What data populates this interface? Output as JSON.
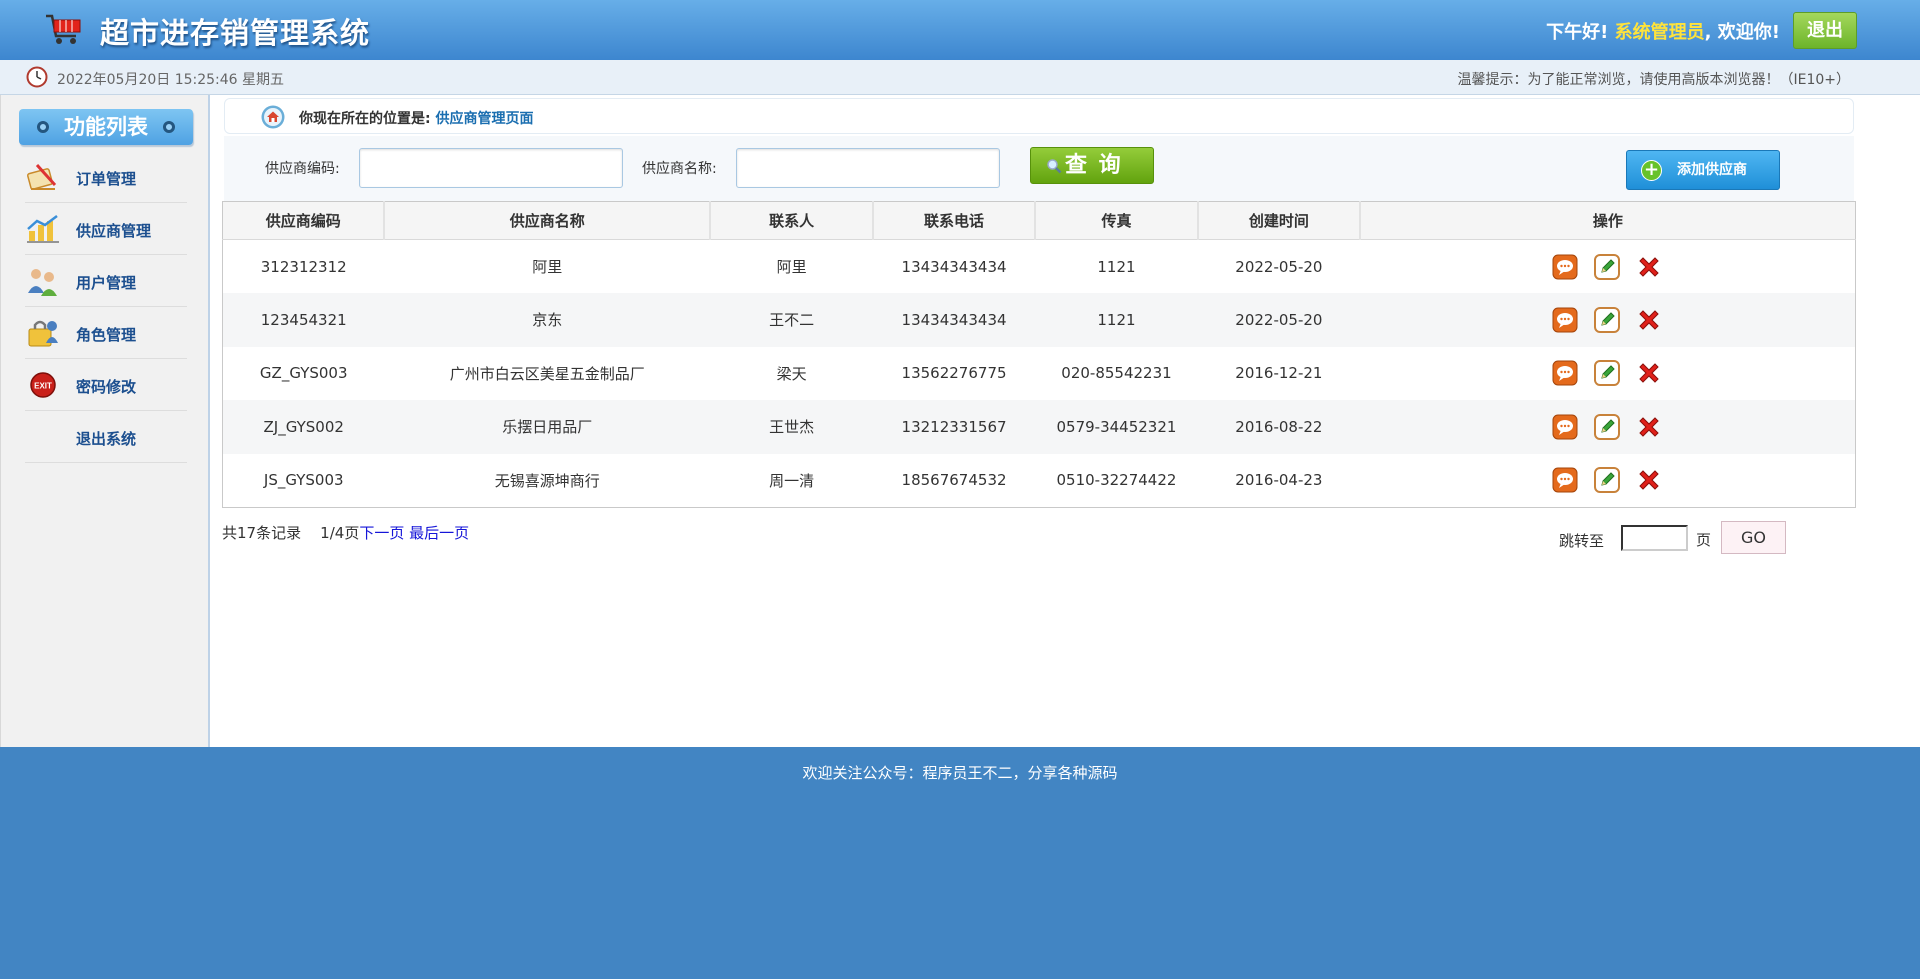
{
  "header": {
    "title": "超市进存销管理系统",
    "greeting_prefix": "下午好!",
    "username": "系统管理员",
    "greeting_suffix": ", 欢迎你!",
    "logout_label": "退出"
  },
  "subbar": {
    "datetime": "2022年05月20日 15:25:46 星期五",
    "tip": "温馨提示：为了能正常浏览，请使用高版本浏览器！（IE10+）"
  },
  "sidebar": {
    "title": "功能列表",
    "items": [
      {
        "label": "订单管理",
        "icon": "order-icon"
      },
      {
        "label": "供应商管理",
        "icon": "supplier-icon"
      },
      {
        "label": "用户管理",
        "icon": "users-icon"
      },
      {
        "label": "角色管理",
        "icon": "role-icon"
      },
      {
        "label": "密码修改",
        "icon": "exit-icon"
      },
      {
        "label": "退出系统",
        "icon": ""
      }
    ]
  },
  "breadcrumb": {
    "prefix": "你现在所在的位置是:",
    "current": "供应商管理页面"
  },
  "search": {
    "code_label": "供应商编码:",
    "code_value": "",
    "name_label": "供应商名称:",
    "name_value": "",
    "query_label": "查 询",
    "add_label": "添加供应商"
  },
  "table": {
    "headers": [
      "供应商编码",
      "供应商名称",
      "联系人",
      "联系电话",
      "传真",
      "创建时间",
      "操作"
    ],
    "rows": [
      {
        "code": "312312312",
        "name": "阿里",
        "contact": "阿里",
        "phone": "13434343434",
        "fax": "1121",
        "created": "2022-05-20"
      },
      {
        "code": "123454321",
        "name": "京东",
        "contact": "王不二",
        "phone": "13434343434",
        "fax": "1121",
        "created": "2022-05-20"
      },
      {
        "code": "GZ_GYS003",
        "name": "广州市白云区美星五金制品厂",
        "contact": "梁天",
        "phone": "13562276775",
        "fax": "020-85542231",
        "created": "2016-12-21"
      },
      {
        "code": "ZJ_GYS002",
        "name": "乐摆日用品厂",
        "contact": "王世杰",
        "phone": "13212331567",
        "fax": "0579-34452321",
        "created": "2016-08-22"
      },
      {
        "code": "JS_GYS003",
        "name": "无锡喜源坤商行",
        "contact": "周一清",
        "phone": "18567674532",
        "fax": "0510-32274422",
        "created": "2016-04-23"
      }
    ]
  },
  "pager": {
    "summary": "共17条记录",
    "page_info": "1/4页",
    "next_label": "下一页",
    "last_label": "最后一页",
    "jump_label": "跳转至",
    "page_unit": "页",
    "go_label": "GO"
  },
  "footer": {
    "text": "欢迎关注公众号：程序员王不二，分享各种源码"
  },
  "colors": {
    "header_top": "#67aee8",
    "header_bottom": "#3d86cf",
    "username": "#ffe33b",
    "footer": "#4285c3",
    "link": "#1a6eb0"
  }
}
